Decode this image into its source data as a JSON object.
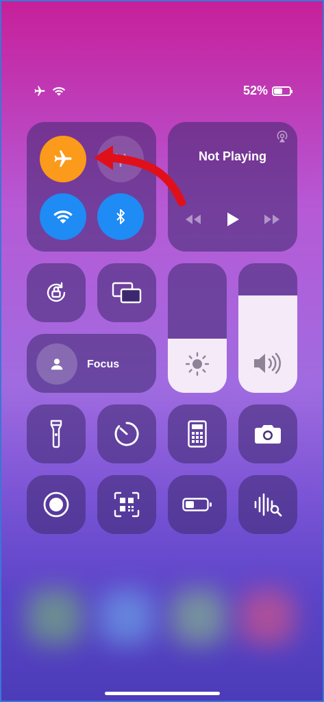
{
  "status_bar": {
    "battery_percent": "52%",
    "battery_level": 0.52,
    "icons": [
      "airplane-icon",
      "wifi-icon"
    ]
  },
  "connectivity": {
    "airplane_mode": {
      "state": "on",
      "icon": "airplane-icon",
      "color": "#fb9a1b"
    },
    "cellular": {
      "state": "off",
      "icon": "cellular-antenna-icon"
    },
    "wifi": {
      "state": "on",
      "icon": "wifi-icon",
      "color": "#1f8bf4"
    },
    "bluetooth": {
      "state": "on",
      "icon": "bluetooth-icon",
      "color": "#1f8bf4"
    }
  },
  "now_playing": {
    "title": "Not Playing",
    "icons": [
      "airplay-icon",
      "rewind-icon",
      "play-icon",
      "fast-forward-icon"
    ]
  },
  "focus": {
    "label": "Focus",
    "icon": "person-icon"
  },
  "sliders": {
    "brightness": {
      "level": 0.42,
      "icon": "sun-icon"
    },
    "volume": {
      "level": 0.75,
      "icon": "speaker-icon"
    }
  },
  "shortcuts": [
    "orientation-lock-icon",
    "screen-mirroring-icon",
    "flashlight-icon",
    "timer-icon",
    "calculator-icon",
    "camera-icon",
    "screen-record-icon",
    "qr-code-scanner-icon",
    "low-power-battery-icon",
    "sound-recognition-icon"
  ],
  "annotation": {
    "arrow_color": "#e0101a"
  }
}
